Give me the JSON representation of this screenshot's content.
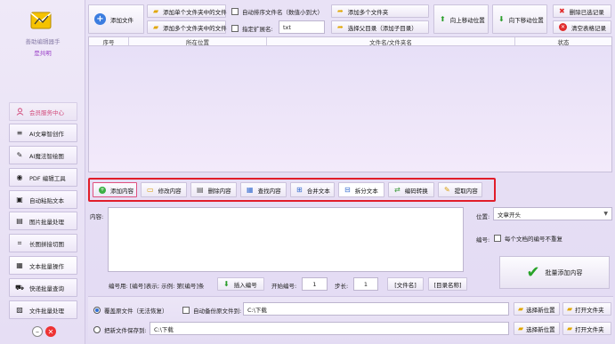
{
  "sidebar": {
    "app_name": "善助编辑器手",
    "user": "是共明",
    "items": [
      {
        "label": "会员服务中心",
        "icon": "user-icon"
      },
      {
        "label": "AI文章智创作",
        "icon": "list-icon"
      },
      {
        "label": "AI魔法智绘图",
        "icon": "magic-wand-icon"
      },
      {
        "label": "PDF 编辑工具",
        "icon": "pdf-icon"
      },
      {
        "label": "自动粘贴文本",
        "icon": "clipboard-icon"
      },
      {
        "label": "图片批量处理",
        "icon": "image-icon"
      },
      {
        "label": "长图拼接切图",
        "icon": "crop-icon"
      },
      {
        "label": "文本批量操作",
        "icon": "document-icon"
      },
      {
        "label": "快递批量查询",
        "icon": "truck-icon"
      },
      {
        "label": "文件批量处理",
        "icon": "folder-edit-icon"
      }
    ]
  },
  "toolbar": {
    "add_file": "添加文件",
    "add_file_single_folder": "添加单个文件夹中的文件",
    "add_file_multi_folder": "添加多个文件夹中的文件",
    "auto_sort": "自动排序文件名（数值小到大）",
    "specify_ext": "指定扩展名:",
    "ext_value": "txt",
    "add_multi_folder": "添加多个文件夹",
    "select_dir": "选择父目录（添加子目录）",
    "move_up": "向上移动位置",
    "move_down": "向下移动位置",
    "delete_selected": "删除已选记录",
    "clear_table": "清空表格记录"
  },
  "table": {
    "headers": [
      "序号",
      "所在位置",
      "文件名/文件夹名",
      "状态"
    ]
  },
  "ops": [
    {
      "label": "添加内容",
      "icon": "add-content-icon"
    },
    {
      "label": "修改内容",
      "icon": "edit-content-icon"
    },
    {
      "label": "删除内容",
      "icon": "delete-content-icon"
    },
    {
      "label": "查找内容",
      "icon": "find-content-icon"
    },
    {
      "label": "合并文本",
      "icon": "merge-text-icon"
    },
    {
      "label": "拆分文本",
      "icon": "split-text-icon"
    },
    {
      "label": "编码转换",
      "icon": "encoding-icon"
    },
    {
      "label": "提取内容",
      "icon": "extract-icon"
    }
  ],
  "content": {
    "label": "内容:",
    "position_label": "位置:",
    "position_value": "文章开头",
    "number_label": "编号:",
    "number_checkbox": "每个文档的编号不重复",
    "numbering_hint": "编号用: [编号]表示; 示例: 第[编号]条",
    "insert_number": "插入编号",
    "start_label": "开始编号:",
    "start_value": "1",
    "step_label": "步长:",
    "step_value": "1",
    "filename_tag": "[文件名]",
    "dirname_tag": "[目录名称]",
    "batch_add": "批量添加内容"
  },
  "output": {
    "overwrite": "覆盖原文件（无法恢复）",
    "auto_backup": "自动备份原文件到:",
    "backup_path": "C:\\下载",
    "save_new": "把新文件保存到:",
    "save_path": "C:\\下载",
    "choose_location": "选择新位置",
    "open_folder": "打开文件夹"
  }
}
